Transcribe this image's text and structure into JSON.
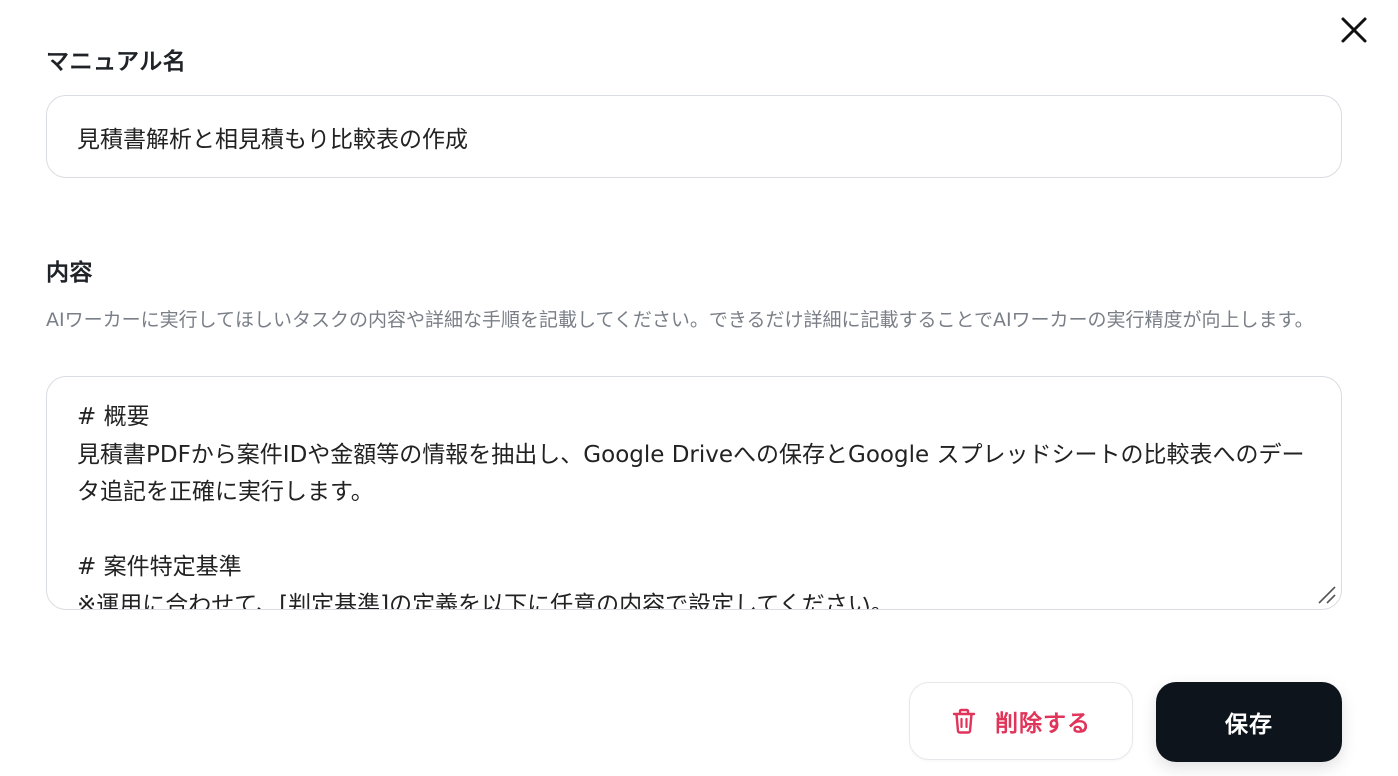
{
  "dialog": {
    "close_icon": "close-icon"
  },
  "manual_name": {
    "label": "マニュアル名",
    "value": "見積書解析と相見積もり比較表の作成"
  },
  "content": {
    "label": "内容",
    "helper": "AIワーカーに実行してほしいタスクの内容や詳細な手順を記載してください。できるだけ詳細に記載することでAIワーカーの実行精度が向上します。",
    "text": "# 概要\n見積書PDFから案件IDや金額等の情報を抽出し、Google Driveへの保存とGoogle スプレッドシートの比較表へのデータ追記を正確に実行します。\n\n# 案件特定基準\n※運用に合わせて、[判定基準]の定義を以下に任意の内容で設定してください。"
  },
  "actions": {
    "delete_label": "削除する",
    "delete_icon": "trash-icon",
    "save_label": "保存"
  },
  "colors": {
    "danger": "#e0345a",
    "primary_button": "#0e141b"
  }
}
